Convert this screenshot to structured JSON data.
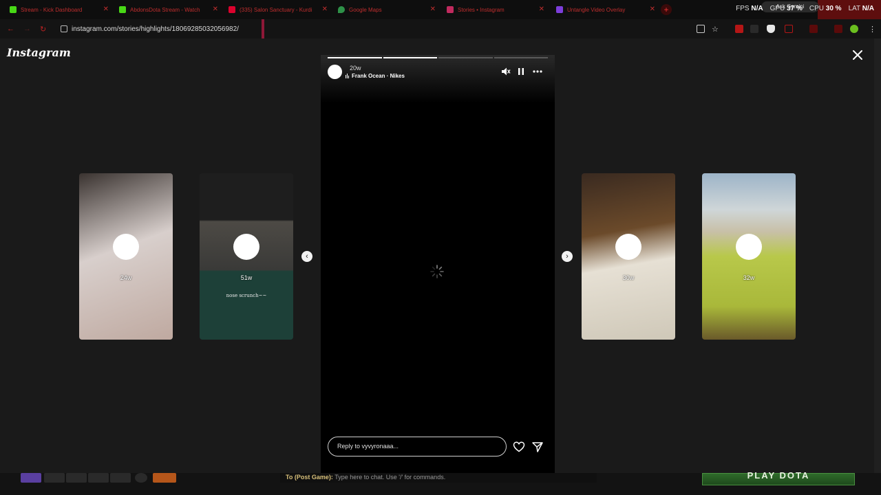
{
  "browser": {
    "tabs": [
      {
        "title": "Stream - Kick Dashboard",
        "color": "#53fc18"
      },
      {
        "title": "AbdonsDota Stream - Watch",
        "color": "#53fc18"
      },
      {
        "title": "(335) Salon Sanctuary - Kurdi",
        "color": "#ff0033"
      },
      {
        "title": "Google Maps",
        "color": "#34a853"
      },
      {
        "title": "Stories • Instagram",
        "color": "#e1306c"
      },
      {
        "title": "Untangle Video Overlay",
        "color": "#9147ff"
      }
    ],
    "url": "instagram.com/stories/highlights/18069285032056982/",
    "gemini_label": "Ask Gemini",
    "stats": {
      "fps_label": "FPS",
      "fps": "N/A",
      "gpu_label": "GPU",
      "gpu": "37 %",
      "cpu_label": "CPU",
      "cpu": "30 %",
      "lat_label": "LAT",
      "lat": "N/A"
    }
  },
  "instagram": {
    "logo": "Instagram",
    "story": {
      "age": "20w",
      "music": "Frank Ocean · Nikes",
      "progress_segments": 4,
      "progress_done": 2,
      "reply_placeholder": "Reply to vyvyronaaa..."
    },
    "previews": [
      {
        "age": "24w",
        "caption": "",
        "bg": "#c9b9b4"
      },
      {
        "age": "51w",
        "caption": "nose scrunch~~",
        "bg": "#1d4038"
      },
      {
        "age": "30w",
        "caption": "",
        "bg": "#b9b4a8"
      },
      {
        "age": "32w",
        "caption": "",
        "bg": "#b8c84a"
      }
    ]
  },
  "game": {
    "chat_prefix": "To (Post Game):",
    "chat_placeholder": "Type here to chat. Use '/' for commands.",
    "play_label": "PLAY DOTA"
  }
}
